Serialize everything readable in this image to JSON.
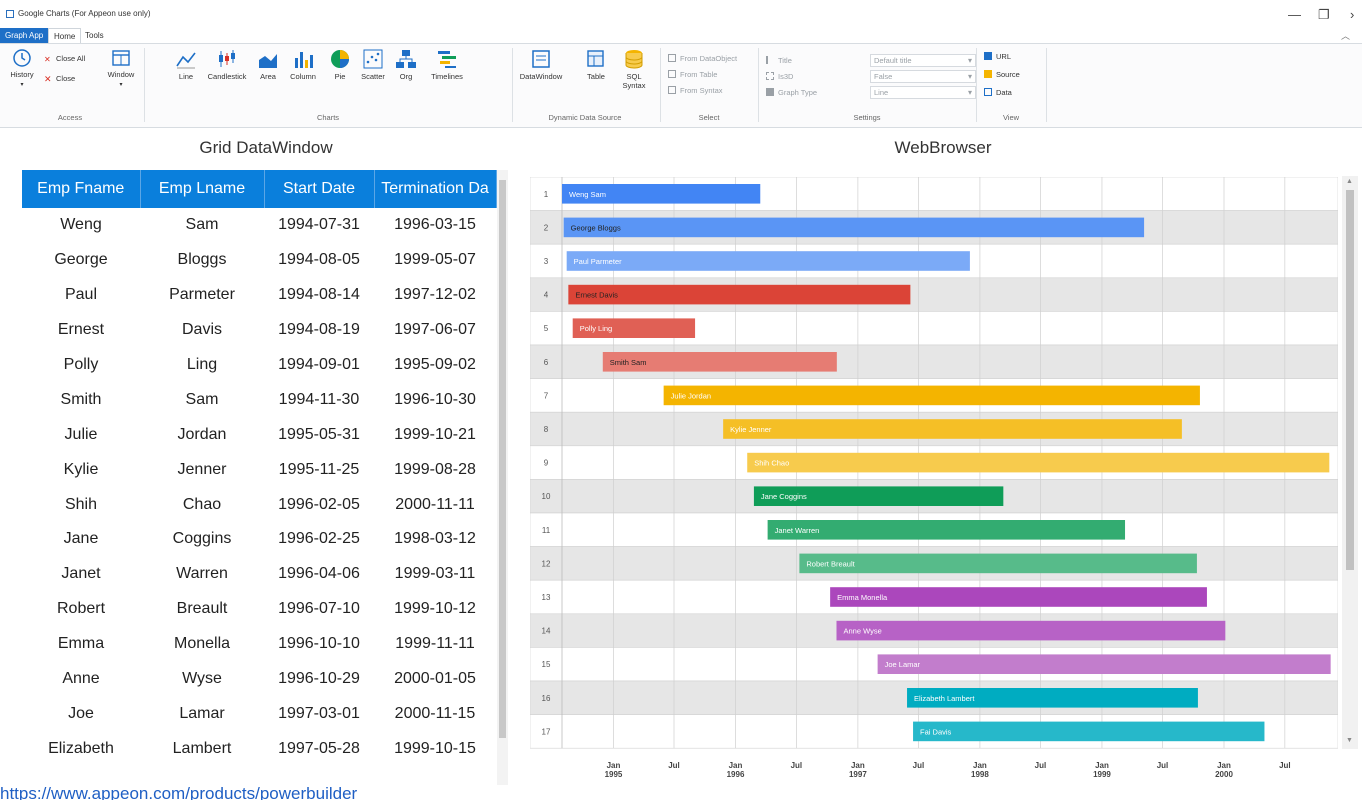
{
  "window": {
    "title": "Google Charts (For Appeon use only)",
    "controls": [
      "—",
      "❐",
      "›"
    ]
  },
  "tabs": [
    {
      "label": "Graph App",
      "state": "active"
    },
    {
      "label": "Home",
      "state": "selected"
    },
    {
      "label": "Tools",
      "state": "normal"
    }
  ],
  "ribbon": {
    "groups": {
      "access": "Access",
      "charts": "Charts",
      "dynamic": "Dynamic Data Source",
      "select": "Select",
      "settings": "Settings",
      "view": "View"
    },
    "access": {
      "history": "History",
      "close_all": "Close All",
      "close": "Close",
      "window": "Window"
    },
    "charts": [
      {
        "label": "Line",
        "icon": "line-chart-icon"
      },
      {
        "label": "Candlestick",
        "icon": "candlestick-chart-icon"
      },
      {
        "label": "Area",
        "icon": "area-chart-icon"
      },
      {
        "label": "Column",
        "icon": "column-chart-icon"
      },
      {
        "label": "Pie",
        "icon": "pie-chart-icon"
      },
      {
        "label": "Scatter",
        "icon": "scatter-chart-icon"
      },
      {
        "label": "Org",
        "icon": "org-chart-icon"
      },
      {
        "label": "Timelines",
        "icon": "timeline-chart-icon"
      }
    ],
    "dynamic": {
      "datawindow": "DataWindow",
      "table": "Table",
      "sql": "SQL",
      "sql2": "Syntax"
    },
    "select": [
      "From DataObject",
      "From Table",
      "From Syntax"
    ],
    "settings": {
      "labels": [
        "Title",
        "Is3D",
        "Graph Type"
      ],
      "values": [
        "Default title",
        "False",
        "Line"
      ]
    },
    "view": [
      "URL",
      "Source",
      "Data"
    ]
  },
  "left_panel_title": "Grid DataWindow",
  "right_panel_title": "WebBrowser",
  "grid": {
    "columns": [
      "Emp Fname",
      "Emp Lname",
      "Start Date",
      "Termination Da"
    ],
    "rows": [
      [
        "Weng",
        "Sam",
        "1994-07-31",
        "1996-03-15"
      ],
      [
        "George",
        "Bloggs",
        "1994-08-05",
        "1999-05-07"
      ],
      [
        "Paul",
        "Parmeter",
        "1994-08-14",
        "1997-12-02"
      ],
      [
        "Ernest",
        "Davis",
        "1994-08-19",
        "1997-06-07"
      ],
      [
        "Polly",
        "Ling",
        "1994-09-01",
        "1995-09-02"
      ],
      [
        "Smith",
        "Sam",
        "1994-11-30",
        "1996-10-30"
      ],
      [
        "Julie",
        "Jordan",
        "1995-05-31",
        "1999-10-21"
      ],
      [
        "Kylie",
        "Jenner",
        "1995-11-25",
        "1999-08-28"
      ],
      [
        "Shih",
        "Chao",
        "1996-02-05",
        "2000-11-11"
      ],
      [
        "Jane",
        "Coggins",
        "1996-02-25",
        "1998-03-12"
      ],
      [
        "Janet",
        "Warren",
        "1996-04-06",
        "1999-03-11"
      ],
      [
        "Robert",
        "Breault",
        "1996-07-10",
        "1999-10-12"
      ],
      [
        "Emma",
        "Monella",
        "1996-10-10",
        "1999-11-11"
      ],
      [
        "Anne",
        "Wyse",
        "1996-10-29",
        "2000-01-05"
      ],
      [
        "Joe",
        "Lamar",
        "1997-03-01",
        "2000-11-15"
      ],
      [
        "Elizabeth",
        "Lambert",
        "1997-05-28",
        "1999-10-15"
      ]
    ]
  },
  "status_link": "https://www.appeon.com/products/powerbuilder",
  "chart_data": {
    "type": "timeline",
    "x_range": [
      "1994-07-31",
      "2000-12-01"
    ],
    "x_ticks": [
      {
        "date": "1995-01-01",
        "label": [
          "Jan",
          "1995"
        ]
      },
      {
        "date": "1995-07-01",
        "label": [
          "Jul"
        ]
      },
      {
        "date": "1996-01-01",
        "label": [
          "Jan",
          "1996"
        ]
      },
      {
        "date": "1996-07-01",
        "label": [
          "Jul"
        ]
      },
      {
        "date": "1997-01-01",
        "label": [
          "Jan",
          "1997"
        ]
      },
      {
        "date": "1997-07-01",
        "label": [
          "Jul"
        ]
      },
      {
        "date": "1998-01-01",
        "label": [
          "Jan",
          "1998"
        ]
      },
      {
        "date": "1998-07-01",
        "label": [
          "Jul"
        ]
      },
      {
        "date": "1999-01-01",
        "label": [
          "Jan",
          "1999"
        ]
      },
      {
        "date": "1999-07-01",
        "label": [
          "Jul"
        ]
      },
      {
        "date": "2000-01-01",
        "label": [
          "Jan",
          "2000"
        ]
      },
      {
        "date": "2000-07-01",
        "label": [
          "Jul"
        ]
      }
    ],
    "rows": [
      {
        "id": "1",
        "name": "Weng Sam",
        "start": "1994-07-31",
        "end": "1996-03-15",
        "color": "#4285f4"
      },
      {
        "id": "2",
        "name": "George Bloggs",
        "start": "1994-08-05",
        "end": "1999-05-07",
        "color": "#5a95f5"
      },
      {
        "id": "3",
        "name": "Paul Parmeter",
        "start": "1994-08-14",
        "end": "1997-12-02",
        "color": "#7baaf7"
      },
      {
        "id": "4",
        "name": "Ernest Davis",
        "start": "1994-08-19",
        "end": "1997-06-07",
        "color": "#db4437"
      },
      {
        "id": "5",
        "name": "Polly Ling",
        "start": "1994-09-01",
        "end": "1995-09-02",
        "color": "#e06055"
      },
      {
        "id": "6",
        "name": "Smith Sam",
        "start": "1994-11-30",
        "end": "1996-10-30",
        "color": "#e67c73"
      },
      {
        "id": "7",
        "name": "Julie Jordan",
        "start": "1995-05-31",
        "end": "1999-10-21",
        "color": "#f4b400"
      },
      {
        "id": "8",
        "name": "Kylie Jenner",
        "start": "1995-11-25",
        "end": "1999-08-28",
        "color": "#f5bf26"
      },
      {
        "id": "9",
        "name": "Shih Chao",
        "start": "1996-02-05",
        "end": "2000-11-11",
        "color": "#f7cb4d"
      },
      {
        "id": "10",
        "name": "Jane Coggins",
        "start": "1996-02-25",
        "end": "1998-03-12",
        "color": "#0f9d58"
      },
      {
        "id": "11",
        "name": "Janet Warren",
        "start": "1996-04-06",
        "end": "1999-03-11",
        "color": "#33ac71"
      },
      {
        "id": "12",
        "name": "Robert Breault",
        "start": "1996-07-10",
        "end": "1999-10-12",
        "color": "#57bb8a"
      },
      {
        "id": "13",
        "name": "Emma Monella",
        "start": "1996-10-10",
        "end": "1999-11-11",
        "color": "#ab47bc"
      },
      {
        "id": "14",
        "name": "Anne Wyse",
        "start": "1996-10-29",
        "end": "2000-01-05",
        "color": "#b762c6"
      },
      {
        "id": "15",
        "name": "Joe Lamar",
        "start": "1997-03-01",
        "end": "2000-11-15",
        "color": "#c27dcc"
      },
      {
        "id": "16",
        "name": "Elizabeth Lambert",
        "start": "1997-05-28",
        "end": "1999-10-15",
        "color": "#00acc1"
      },
      {
        "id": "17",
        "name": "Fai Davis",
        "start": "1997-06-15",
        "end": "2000-05-01",
        "color": "#26b8ca"
      }
    ]
  }
}
